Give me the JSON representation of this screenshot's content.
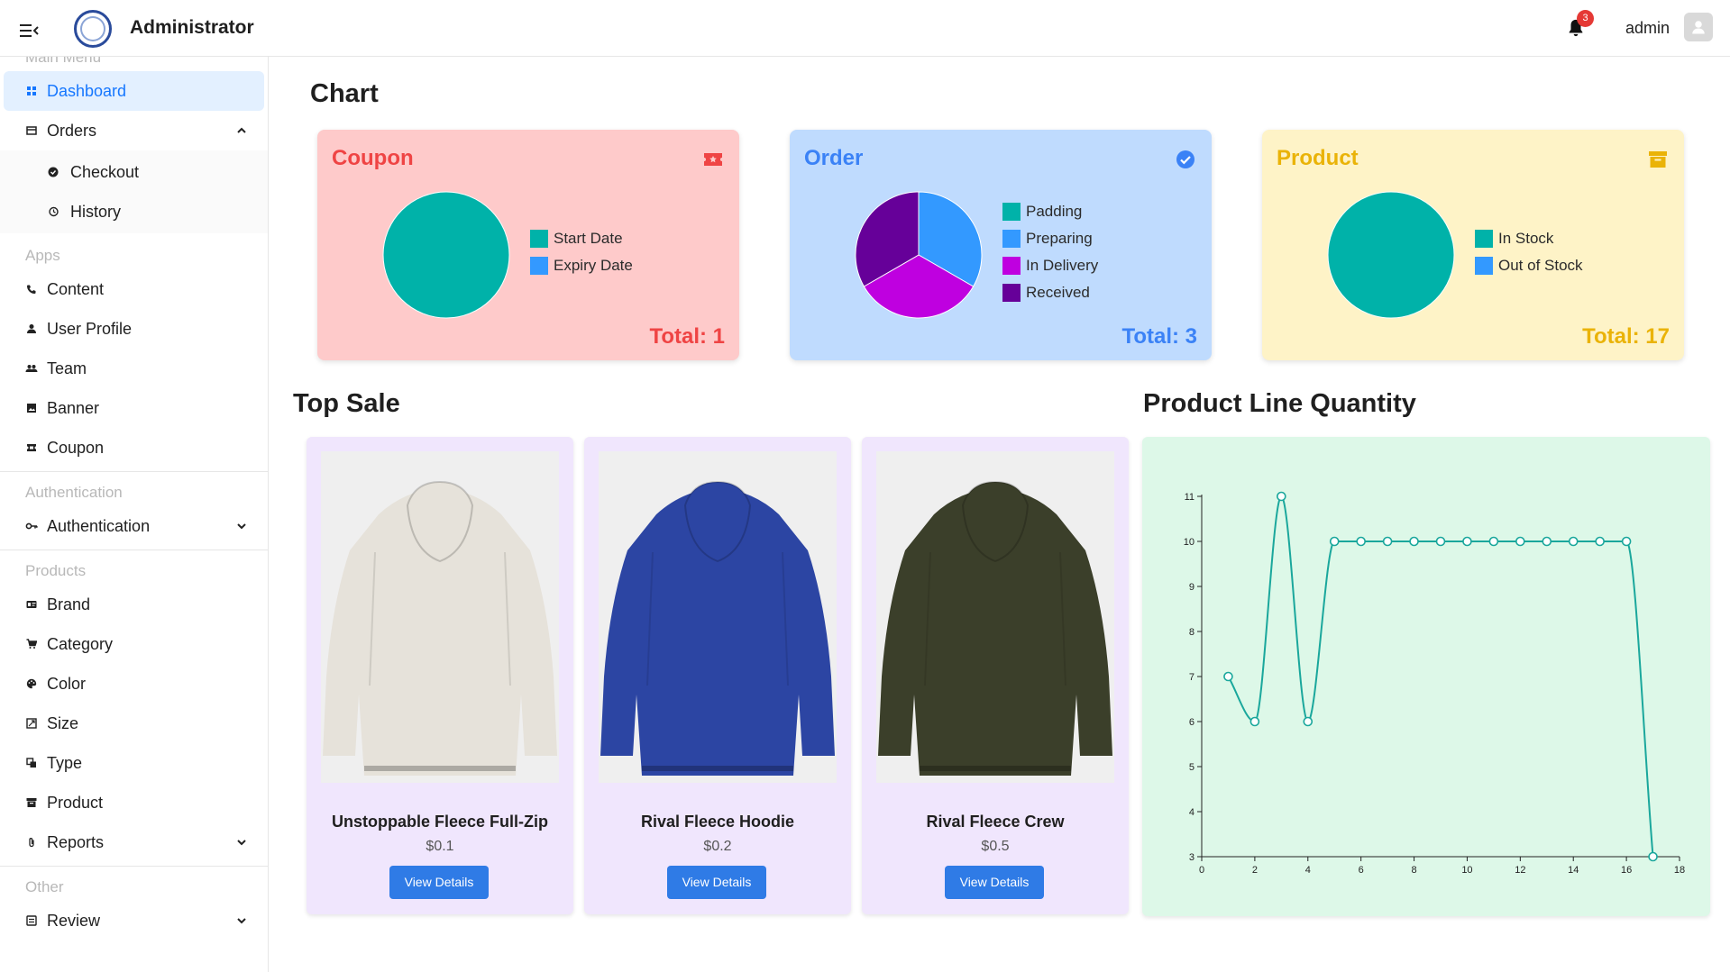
{
  "header": {
    "title": "Administrator",
    "notification_count": "3",
    "user_name": "admin"
  },
  "sidebar": {
    "sections": {
      "main_menu": "Main Menu",
      "apps": "Apps",
      "authentication": "Authentication",
      "products": "Products",
      "other": "Other"
    },
    "items": {
      "dashboard": "Dashboard",
      "orders": "Orders",
      "checkout": "Checkout",
      "history": "History",
      "content": "Content",
      "user_profile": "User Profile",
      "team": "Team",
      "banner": "Banner",
      "coupon": "Coupon",
      "authentication": "Authentication",
      "brand": "Brand",
      "category": "Category",
      "color": "Color",
      "size": "Size",
      "type": "Type",
      "product": "Product",
      "reports": "Reports",
      "review": "Review"
    }
  },
  "main": {
    "chart_heading": "Chart",
    "top_sale_heading": "Top Sale",
    "line_heading": "Product Line Quantity"
  },
  "cards": {
    "coupon": {
      "title": "Coupon",
      "total": "Total: 1",
      "legend": [
        "Start Date",
        "Expiry Date"
      ],
      "bg": "#fecaca",
      "accent": "#ef4444"
    },
    "order": {
      "title": "Order",
      "total": "Total: 3",
      "legend": [
        "Padding",
        "Preparing",
        "In Delivery",
        "Received"
      ],
      "bg": "#bfdbfe",
      "accent": "#3b82f6"
    },
    "product": {
      "title": "Product",
      "total": "Total: 17",
      "legend": [
        "In Stock",
        "Out of Stock"
      ],
      "bg": "#fef3c7",
      "accent": "#eab308"
    }
  },
  "top_sale": [
    {
      "name": "Unstoppable Fleece Full-Zip",
      "price": "$0.1",
      "button": "View Details",
      "color": "#e6e2da"
    },
    {
      "name": "Rival Fleece Hoodie",
      "price": "$0.2",
      "button": "View Details",
      "color": "#2c45a3"
    },
    {
      "name": "Rival Fleece Crew",
      "price": "$0.5",
      "button": "View Details",
      "color": "#3b3f2a"
    }
  ],
  "chart_data": [
    {
      "type": "pie",
      "categories": [
        "Start Date",
        "Expiry Date"
      ],
      "values": [
        1,
        0
      ],
      "colors": [
        "#00b2a9",
        "#3399ff"
      ]
    },
    {
      "type": "pie",
      "categories": [
        "Padding",
        "Preparing",
        "In Delivery",
        "Received"
      ],
      "values": [
        0,
        1,
        1,
        1
      ],
      "colors": [
        "#00b2a9",
        "#3399ff",
        "#bf00e0",
        "#660099"
      ]
    },
    {
      "type": "pie",
      "categories": [
        "In Stock",
        "Out of Stock"
      ],
      "values": [
        17,
        0
      ],
      "colors": [
        "#00b2a9",
        "#3399ff"
      ]
    },
    {
      "type": "line",
      "x": [
        1,
        2,
        3,
        4,
        5,
        6,
        7,
        8,
        9,
        10,
        11,
        12,
        13,
        14,
        15,
        16,
        17
      ],
      "y": [
        7,
        6,
        11,
        6,
        10,
        10,
        10,
        10,
        10,
        10,
        10,
        10,
        10,
        10,
        10,
        10,
        3
      ],
      "xlim": [
        0,
        18
      ],
      "ylim": [
        3,
        11
      ],
      "xticks": [
        0,
        2,
        4,
        6,
        8,
        10,
        12,
        14,
        16,
        18
      ],
      "yticks": [
        3,
        4,
        5,
        6,
        7,
        8,
        9,
        10,
        11
      ],
      "color": "#1aa79c",
      "smooth": true,
      "grid": false
    }
  ]
}
